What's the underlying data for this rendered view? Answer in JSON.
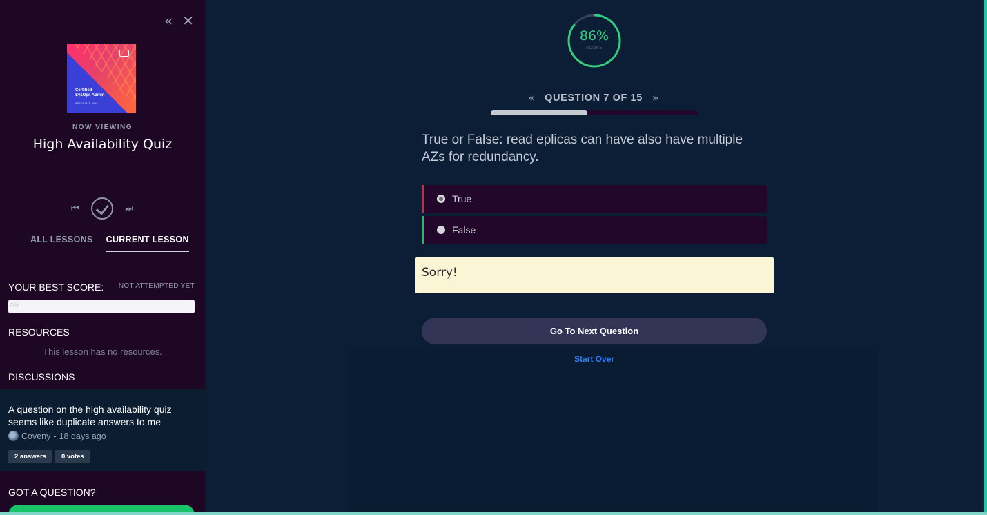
{
  "sidebar": {
    "collapse_icon": "double-chevron-left-icon",
    "close_icon": "close-icon",
    "cover": {
      "line1": "Certified",
      "line2": "SysOps Admin",
      "line3": "ASSOCIATE 2018"
    },
    "now_viewing": "NOW VIEWING",
    "lesson_title": "High Availability Quiz",
    "tabs": [
      {
        "label": "ALL LESSONS",
        "active": false
      },
      {
        "label": "CURRENT LESSON",
        "active": true
      }
    ],
    "best_score_label": "YOUR BEST SCORE:",
    "best_score_status": "NOT ATTEMPTED YET",
    "best_score_bar_text": "0%",
    "resources_label": "RESOURCES",
    "no_resources": "This lesson has no resources.",
    "discussions_label": "DISCUSSIONS",
    "discussion": {
      "title": "A question on the high availability quiz seems like duplicate answers to me",
      "author": "Coveny",
      "time": "18 days ago",
      "answers": "2 answers",
      "votes": "0 votes"
    },
    "got_question": "GOT A QUESTION?"
  },
  "score": {
    "percent_text": "86%",
    "percent_value": 86,
    "label": "SCORE",
    "color": "#2fd07e"
  },
  "quiz": {
    "question_label": "QUESTION 7 OF 15",
    "current": 7,
    "total": 15,
    "question_text": "True or False: read eplicas can have also have multiple AZs for redundancy.",
    "answers": [
      {
        "label": "True",
        "selected": true,
        "status": "wrong"
      },
      {
        "label": "False",
        "selected": false,
        "status": "correct"
      }
    ],
    "feedback": "Sorry!",
    "next_button": "Go To Next Question",
    "start_over": "Start Over"
  }
}
